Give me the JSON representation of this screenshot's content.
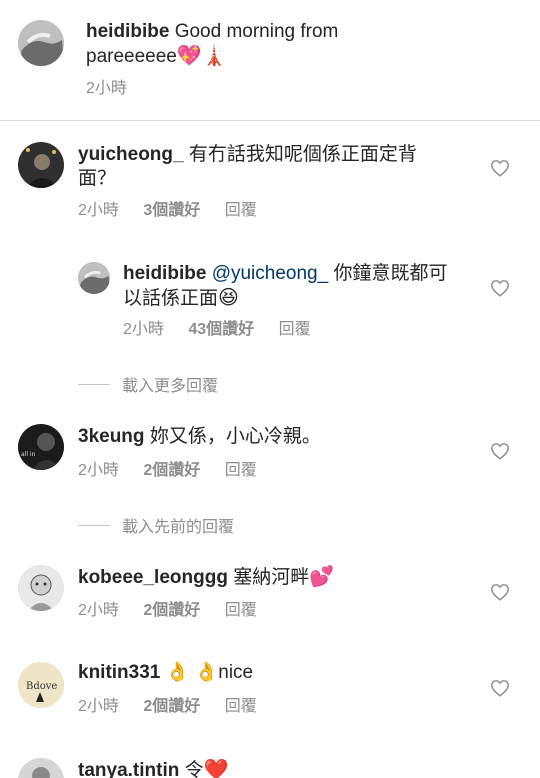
{
  "caption": {
    "username": "heidibibe",
    "text": "Good morning from pareeeeee",
    "emojis": "💖🗼",
    "time": "2小時"
  },
  "comments": [
    {
      "username": "yuicheong_",
      "text": "有冇話我知呢個係正面定背面？",
      "time": "2小時",
      "likes": "3個讚好",
      "reply": "回覆"
    },
    {
      "username": "heidibibe",
      "mention": "@yuicheong_",
      "text": "你鐘意既都可以話係正面",
      "emoji": "😆",
      "time": "2小時",
      "likes": "43個讚好",
      "reply": "回覆"
    },
    {
      "username": "3keung",
      "text": "妳又係，小心冷親。",
      "time": "2小時",
      "likes": "2個讚好",
      "reply": "回覆"
    },
    {
      "username": "kobeee_leonggg",
      "text": "塞納河畔",
      "emoji": "💕",
      "time": "2小時",
      "likes": "2個讚好",
      "reply": "回覆"
    },
    {
      "username": "knitin331",
      "text": "👌 👌nice",
      "time": "2小時",
      "likes": "2個讚好",
      "reply": "回覆"
    },
    {
      "username": "tanya.tintin",
      "text": "令",
      "emoji": "❤️"
    }
  ],
  "load_more_replies": "載入更多回覆",
  "load_previous_replies": "載入先前的回覆"
}
